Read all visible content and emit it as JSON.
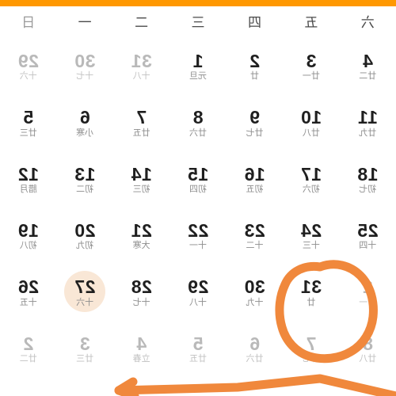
{
  "app": {
    "accent_color": "#ff9800",
    "selected_fill": "#f9e7d6",
    "annotation_color": "#f0883c"
  },
  "week_header": [
    {
      "label": "六",
      "muted": false
    },
    {
      "label": "五",
      "muted": false
    },
    {
      "label": "四",
      "muted": false
    },
    {
      "label": "三",
      "muted": false
    },
    {
      "label": "二",
      "muted": false
    },
    {
      "label": "一",
      "muted": false
    },
    {
      "label": "日",
      "muted": true
    }
  ],
  "days": [
    {
      "num": "4",
      "lunar": "廿二",
      "out": false,
      "sel": false
    },
    {
      "num": "3",
      "lunar": "廿一",
      "out": false,
      "sel": false
    },
    {
      "num": "2",
      "lunar": "廿",
      "out": false,
      "sel": false
    },
    {
      "num": "1",
      "lunar": "元旦",
      "out": false,
      "sel": false
    },
    {
      "num": "31",
      "lunar": "十八",
      "out": true,
      "sel": false
    },
    {
      "num": "30",
      "lunar": "十七",
      "out": true,
      "sel": false
    },
    {
      "num": "29",
      "lunar": "十六",
      "out": true,
      "sel": false
    },
    {
      "num": "11",
      "lunar": "廿九",
      "out": false,
      "sel": false
    },
    {
      "num": "10",
      "lunar": "廿八",
      "out": false,
      "sel": false
    },
    {
      "num": "9",
      "lunar": "廿七",
      "out": false,
      "sel": false
    },
    {
      "num": "8",
      "lunar": "廿六",
      "out": false,
      "sel": false
    },
    {
      "num": "7",
      "lunar": "廿五",
      "out": false,
      "sel": false
    },
    {
      "num": "6",
      "lunar": "小寒",
      "out": false,
      "sel": false
    },
    {
      "num": "5",
      "lunar": "廿三",
      "out": false,
      "sel": false
    },
    {
      "num": "18",
      "lunar": "初七",
      "out": false,
      "sel": false
    },
    {
      "num": "17",
      "lunar": "初六",
      "out": false,
      "sel": false
    },
    {
      "num": "16",
      "lunar": "初五",
      "out": false,
      "sel": false
    },
    {
      "num": "15",
      "lunar": "初四",
      "out": false,
      "sel": false
    },
    {
      "num": "14",
      "lunar": "初三",
      "out": false,
      "sel": false
    },
    {
      "num": "13",
      "lunar": "初二",
      "out": false,
      "sel": false
    },
    {
      "num": "12",
      "lunar": "腊月",
      "out": false,
      "sel": false
    },
    {
      "num": "25",
      "lunar": "十四",
      "out": false,
      "sel": false
    },
    {
      "num": "24",
      "lunar": "十三",
      "out": false,
      "sel": false
    },
    {
      "num": "23",
      "lunar": "十二",
      "out": false,
      "sel": false
    },
    {
      "num": "22",
      "lunar": "十一",
      "out": false,
      "sel": false
    },
    {
      "num": "21",
      "lunar": "大寒",
      "out": false,
      "sel": false
    },
    {
      "num": "20",
      "lunar": "初九",
      "out": false,
      "sel": false
    },
    {
      "num": "19",
      "lunar": "初八",
      "out": false,
      "sel": false
    },
    {
      "num": "1",
      "lunar": "廿一",
      "out": true,
      "sel": false
    },
    {
      "num": "31",
      "lunar": "廿",
      "out": false,
      "sel": false
    },
    {
      "num": "30",
      "lunar": "十九",
      "out": false,
      "sel": false
    },
    {
      "num": "29",
      "lunar": "十八",
      "out": false,
      "sel": false
    },
    {
      "num": "28",
      "lunar": "十七",
      "out": false,
      "sel": false
    },
    {
      "num": "27",
      "lunar": "十六",
      "out": false,
      "sel": true
    },
    {
      "num": "26",
      "lunar": "十五",
      "out": false,
      "sel": false
    },
    {
      "num": "8",
      "lunar": "廿八",
      "out": true,
      "sel": false
    },
    {
      "num": "7",
      "lunar": "廿七",
      "out": true,
      "sel": false
    },
    {
      "num": "6",
      "lunar": "廿六",
      "out": true,
      "sel": false
    },
    {
      "num": "5",
      "lunar": "廿五",
      "out": true,
      "sel": false
    },
    {
      "num": "4",
      "lunar": "立春",
      "out": true,
      "sel": false
    },
    {
      "num": "3",
      "lunar": "廿三",
      "out": true,
      "sel": false
    },
    {
      "num": "2",
      "lunar": "廿二",
      "out": true,
      "sel": false
    }
  ]
}
